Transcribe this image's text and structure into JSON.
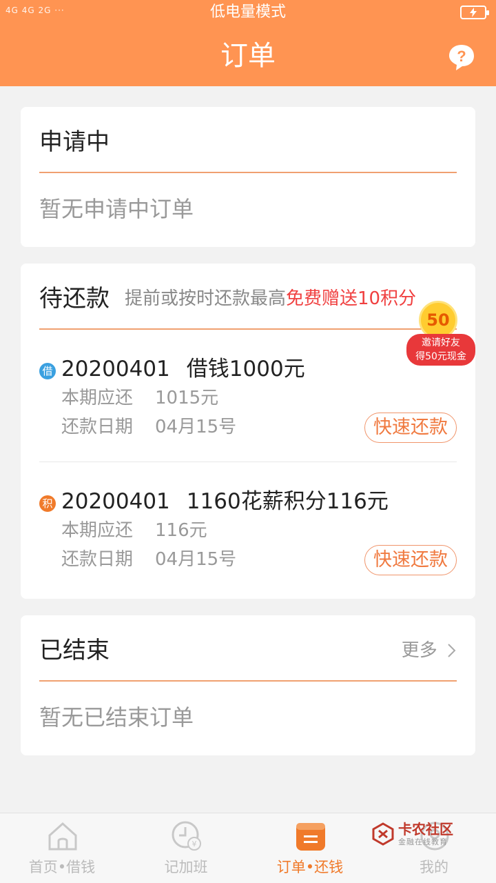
{
  "status_bar": {
    "signal_text": "4G 4G   2G",
    "dots": "···",
    "mode_text": "低电量模式"
  },
  "header": {
    "title": "订单",
    "help_icon": "question-icon"
  },
  "applying": {
    "title": "申请中",
    "empty_text": "暂无申请中订单"
  },
  "repay": {
    "title": "待还款",
    "tip_prefix": "提前或按时还款最高",
    "tip_highlight": "免费赠送10积分",
    "orders": [
      {
        "badge": "借",
        "badge_color": "#3aa0e0",
        "date": "20200401",
        "desc": "借钱1000元",
        "due_label": "本期应还",
        "due_value": "1015元",
        "date_label": "还款日期",
        "date_value": "04月15号",
        "button": "快速还款"
      },
      {
        "badge": "积",
        "badge_color": "#f07a2a",
        "date": "20200401",
        "desc": "1160花薪积分116元",
        "due_label": "本期应还",
        "due_value": "116元",
        "date_label": "还款日期",
        "date_value": "04月15号",
        "button": "快速还款"
      }
    ]
  },
  "finished": {
    "title": "已结束",
    "more": "更多",
    "empty_text": "暂无已结束订单"
  },
  "invite": {
    "coin": "50",
    "line1": "邀请好友",
    "line2": "得50元现金"
  },
  "tabs": [
    {
      "label": "首页•借钱",
      "icon": "home-icon",
      "active": false
    },
    {
      "label": "记加班",
      "icon": "clock-icon",
      "active": false
    },
    {
      "label": "订单•还钱",
      "icon": "order-icon",
      "active": true
    },
    {
      "label": "我的",
      "icon": "profile-icon",
      "active": false
    }
  ],
  "watermark": {
    "title": "卡农社区",
    "subtitle": "金融在线教育"
  },
  "colors": {
    "brand": "#ff9452",
    "accent": "#f07a2a",
    "highlight": "#f04040"
  }
}
